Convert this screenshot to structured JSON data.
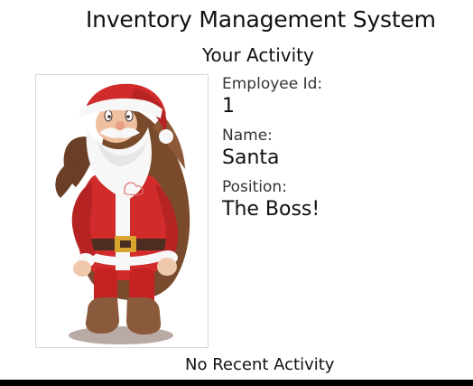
{
  "header": {
    "app_title": "Inventory Management System"
  },
  "section": {
    "title": "Your Activity"
  },
  "employee": {
    "avatar_icon": "santa-avatar-icon",
    "employee_id_label": "Employee Id:",
    "employee_id_value": "1",
    "name_label": "Name:",
    "name_value": "Santa",
    "position_label": "Position:",
    "position_value": "The Boss!"
  },
  "activity": {
    "empty_message": "No Recent Activity"
  },
  "colors": {
    "santa_red": "#d12b2b",
    "santa_dark_red": "#8e1e1e",
    "beard_white": "#f7f7f7",
    "sack_brown": "#7a4a2d",
    "boot_brown": "#8b5a3c",
    "belt_gold": "#d9a52f",
    "bottom_bar": "#000000"
  }
}
